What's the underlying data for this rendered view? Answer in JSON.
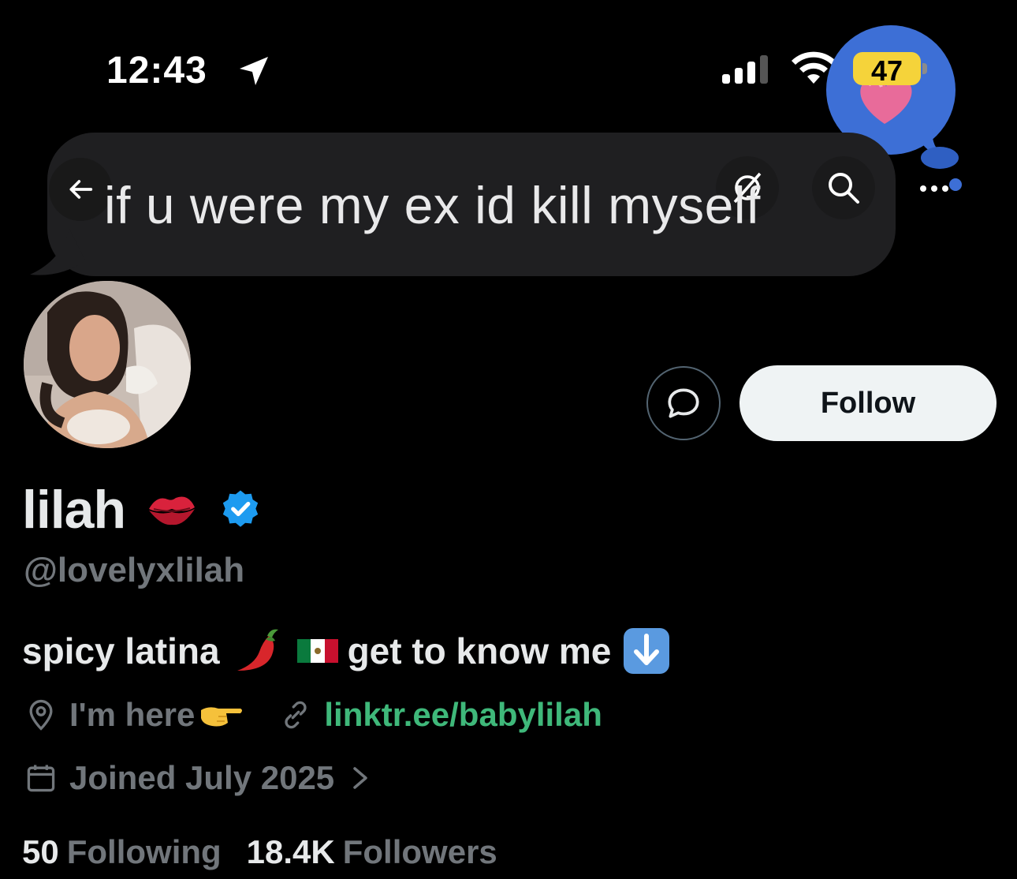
{
  "status_bar": {
    "time": "12:43",
    "battery": "47"
  },
  "overlay_message": {
    "text": "if u were my ex id kill myself"
  },
  "profile": {
    "display_name": "lilah",
    "handle": "@lovelyxlilah",
    "follow_label": "Follow",
    "bio": {
      "part1": "spicy latina",
      "part2": "get to know me"
    },
    "location": "I'm here",
    "link": "linktr.ee/babylilah",
    "joined": "Joined July 2025",
    "following_count": "50",
    "following_label": "Following",
    "followers_count": "18.4K",
    "followers_label": "Followers"
  },
  "colors": {
    "background": "#000000",
    "text_primary": "#e7e9ea",
    "text_secondary": "#71767b",
    "link": "#3fb87a",
    "verified": "#1d9bf0",
    "follow_button_bg": "#eff3f4",
    "sticker_blue": "#3d6fd6",
    "battery_yellow": "#f5d33a"
  },
  "icons": [
    "location-arrow-icon",
    "signal-icon",
    "wifi-icon",
    "battery-icon",
    "back-arrow-icon",
    "ghost-icon",
    "search-icon",
    "more-icon",
    "message-icon",
    "lips-icon",
    "verified-icon",
    "chili-icon",
    "mexico-flag-icon",
    "down-arrow-icon",
    "location-pin-icon",
    "pointing-hand-icon",
    "link-icon",
    "calendar-icon",
    "chevron-right-icon"
  ]
}
